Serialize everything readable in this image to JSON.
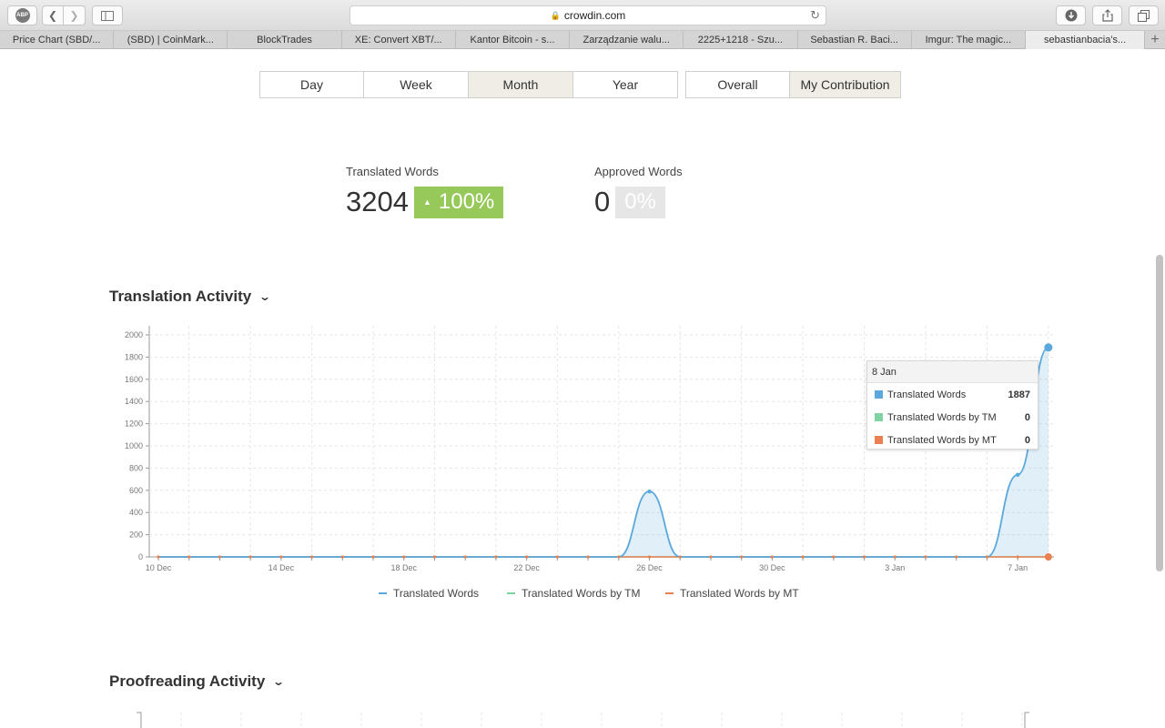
{
  "browser": {
    "url": "crowdin.com",
    "adblock_label": "ABP",
    "tabs": [
      "Price Chart (SBD/...",
      "(SBD) | CoinMark...",
      "BlockTrades",
      "XE: Convert XBT/...",
      "Kantor Bitcoin - s...",
      "Zarządzanie walu...",
      "2225+1218 - Szu...",
      "Sebastian R. Baci...",
      "Imgur: The magic...",
      "sebastianbacia's..."
    ],
    "active_tab_index": 9
  },
  "period_buttons": [
    "Day",
    "Week",
    "Month",
    "Year"
  ],
  "selected_period": "Month",
  "scope_buttons": [
    "Overall",
    "My Contribution"
  ],
  "selected_scope": "My Contribution",
  "stats": {
    "translated": {
      "label": "Translated Words",
      "value": "3204",
      "change": "100%"
    },
    "approved": {
      "label": "Approved Words",
      "value": "0",
      "change": "0%"
    }
  },
  "translation_activity": {
    "title": "Translation Activity"
  },
  "proofreading_activity": {
    "title": "Proofreading Activity"
  },
  "colors": {
    "translated": "#5aa8dc",
    "translated_tm": "#7fd3a0",
    "translated_mt": "#ea8051",
    "positive_badge": "#96c85a"
  },
  "tooltip": {
    "date": "8 Jan",
    "rows": [
      {
        "name": "Translated Words",
        "value": "1887"
      },
      {
        "name": "Translated Words by TM",
        "value": "0"
      },
      {
        "name": "Translated Words by MT",
        "value": "0"
      }
    ]
  },
  "chart_data": {
    "type": "area",
    "title": "Translation Activity",
    "x": [
      "10 Dec",
      "11 Dec",
      "12 Dec",
      "13 Dec",
      "14 Dec",
      "15 Dec",
      "16 Dec",
      "17 Dec",
      "18 Dec",
      "19 Dec",
      "20 Dec",
      "21 Dec",
      "22 Dec",
      "23 Dec",
      "24 Dec",
      "25 Dec",
      "26 Dec",
      "27 Dec",
      "28 Dec",
      "29 Dec",
      "30 Dec",
      "31 Dec",
      "1 Jan",
      "2 Jan",
      "3 Jan",
      "4 Jan",
      "5 Jan",
      "6 Jan",
      "7 Jan",
      "8 Jan"
    ],
    "x_tick_labels": [
      "10 Dec",
      "14 Dec",
      "18 Dec",
      "22 Dec",
      "26 Dec",
      "30 Dec",
      "3 Jan",
      "7 Jan"
    ],
    "series": [
      {
        "name": "Translated Words",
        "values": [
          0,
          0,
          0,
          0,
          0,
          0,
          0,
          0,
          0,
          0,
          0,
          0,
          0,
          0,
          0,
          0,
          590,
          0,
          0,
          0,
          0,
          0,
          0,
          0,
          0,
          0,
          0,
          0,
          740,
          1887
        ]
      },
      {
        "name": "Translated Words by TM",
        "values": [
          0,
          0,
          0,
          0,
          0,
          0,
          0,
          0,
          0,
          0,
          0,
          0,
          0,
          0,
          0,
          0,
          0,
          0,
          0,
          0,
          0,
          0,
          0,
          0,
          0,
          0,
          0,
          0,
          0,
          0
        ]
      },
      {
        "name": "Translated Words by MT",
        "values": [
          0,
          0,
          0,
          0,
          0,
          0,
          0,
          0,
          0,
          0,
          0,
          0,
          0,
          0,
          0,
          0,
          0,
          0,
          0,
          0,
          0,
          0,
          0,
          0,
          0,
          0,
          0,
          0,
          0,
          0
        ]
      }
    ],
    "ylim": [
      0,
      2000
    ],
    "y_ticks": [
      0,
      200,
      400,
      600,
      800,
      1000,
      1200,
      1400,
      1600,
      1800,
      2000
    ],
    "grid": true,
    "legend_position": "bottom"
  }
}
